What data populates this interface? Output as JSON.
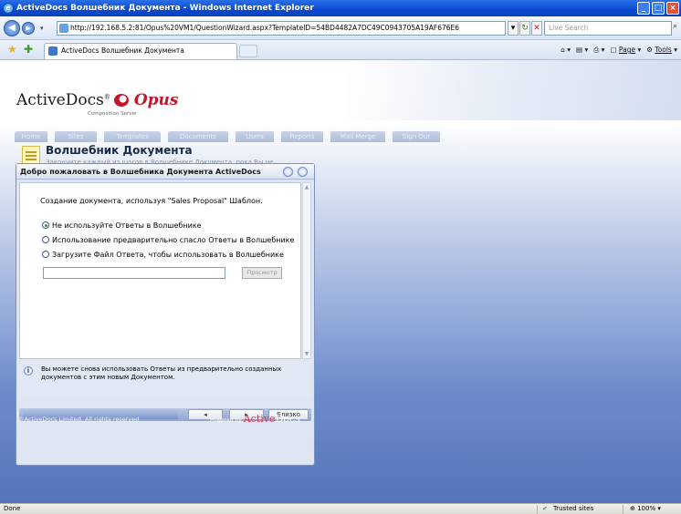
{
  "window": {
    "title": "ActiveDocs Волшебник Документа - Windows Internet Explorer"
  },
  "browser": {
    "url": "http://192.168.5.2:81/Opus%20VM1/QuestionWizard.aspx?TemplateID=54BD4482A7DC49C0943705A19AF676E6",
    "search_placeholder": "Live Search",
    "tab_title": "ActiveDocs Волшебник Документа",
    "page_menu": "Page",
    "tools_menu": "Tools"
  },
  "app": {
    "logo_text": "ActiveDocs",
    "logo_brand": "Opus",
    "logo_sub": "Composition Server",
    "nav": [
      "Home",
      "Sites",
      "Templates",
      "Documents",
      "Users",
      "Reports",
      "Mail Merge",
      "Sign Out"
    ],
    "page_title": "Волшебник Документа",
    "page_subtitle": "Закончите каждый из шагов в Волшебнике Документа, пока Вы не закончили."
  },
  "dialog": {
    "title": "Добро пожаловать в Волшебника Документа ActiveDocs",
    "intro": "Создание документа, используя \"Sales Proposal\" Шаблон.",
    "options": [
      {
        "label": "Не используйте Ответы в Волшебнике",
        "selected": true
      },
      {
        "label": "Использование предварительно спасло Ответы в Волшебнике",
        "selected": false
      },
      {
        "label": "Загрузите Файл Ответа, чтобы использовать в Волшебнике",
        "selected": false
      }
    ],
    "file_value": "",
    "browse_label": "Просмотр",
    "info_text": "Вы можете снова использовать Ответы из предварительно созданных документов с этим новым Документом.",
    "prev_label": "◂",
    "next_label": "▸",
    "finish_label": "Близко"
  },
  "footer": {
    "copyright": "©ActiveDocs Limited. All rights reserved",
    "powered_prefix": "Powered by",
    "powered_brand_a": "Active",
    "powered_brand_b": "Docs"
  },
  "status": {
    "left": "Done",
    "zone": "Trusted sites",
    "zoom": "100%"
  }
}
